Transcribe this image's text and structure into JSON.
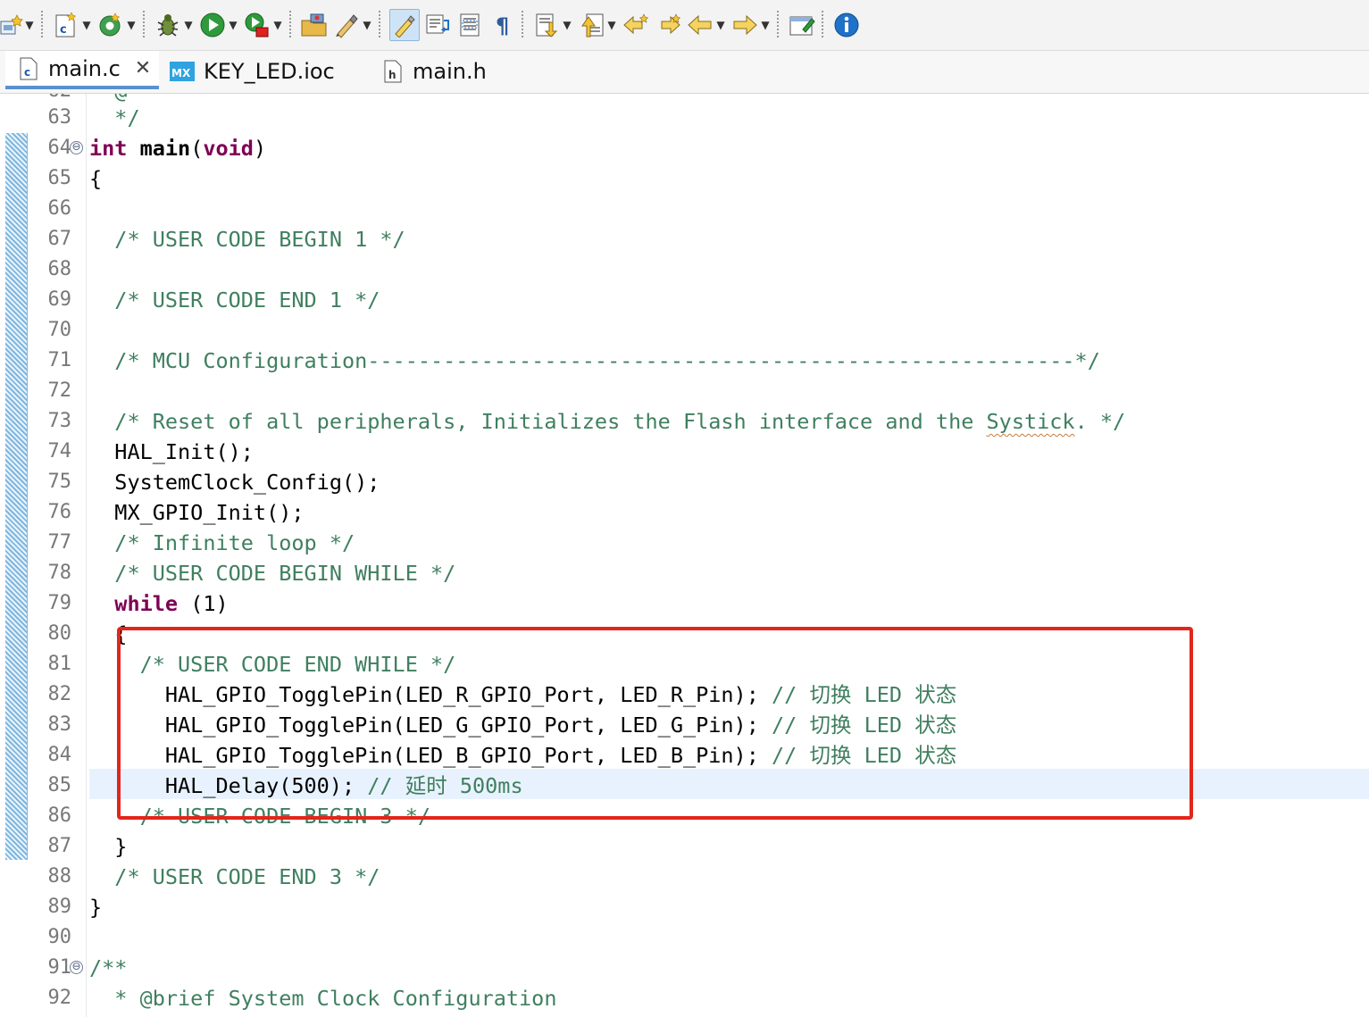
{
  "toolbar": {
    "icons": [
      "new-wizard-icon",
      "new-c-file-icon",
      "build-icon",
      "debug-icon",
      "run-icon",
      "external-tools-icon",
      "open-folder-icon",
      "toggle-mark-icon",
      "highlight-icon",
      "word-wrap-icon",
      "block-select-icon",
      "pilcrow-icon",
      "next-annotation-icon",
      "prev-annotation-icon",
      "last-edit-back-icon",
      "last-edit-forward-icon",
      "back-icon",
      "forward-icon",
      "open-perspective-icon",
      "info-icon"
    ],
    "accent": "#1e72c8"
  },
  "tabs": [
    {
      "label": "main.c",
      "icon": "c-file-icon",
      "active": true
    },
    {
      "label": "KEY_LED.ioc",
      "icon": "mx-ioc-icon",
      "active": false
    },
    {
      "label": "main.h",
      "icon": "h-file-icon",
      "active": false
    }
  ],
  "editor": {
    "lines": [
      {
        "n": "63",
        "text": "  */"
      },
      {
        "n": "64",
        "text": "int main(void)",
        "fold": "⊖"
      },
      {
        "n": "65",
        "text": "{"
      },
      {
        "n": "66",
        "text": ""
      },
      {
        "n": "67",
        "text": "  /* USER CODE BEGIN 1 */"
      },
      {
        "n": "68",
        "text": ""
      },
      {
        "n": "69",
        "text": "  /* USER CODE END 1 */"
      },
      {
        "n": "70",
        "text": ""
      },
      {
        "n": "71",
        "text": "  /* MCU Configuration--------------------------------------------------------*/"
      },
      {
        "n": "72",
        "text": ""
      },
      {
        "n": "73",
        "text": "  /* Reset of all peripherals, Initializes the Flash interface and the Systick. */"
      },
      {
        "n": "74",
        "text": "  HAL_Init();"
      },
      {
        "n": "75",
        "text": "  SystemClock_Config();"
      },
      {
        "n": "76",
        "text": "  MX_GPIO_Init();"
      },
      {
        "n": "77",
        "text": "  /* Infinite loop */"
      },
      {
        "n": "78",
        "text": "  /* USER CODE BEGIN WHILE */"
      },
      {
        "n": "79",
        "text": "  while (1)"
      },
      {
        "n": "80",
        "text": "  {"
      },
      {
        "n": "81",
        "text": "    /* USER CODE END WHILE */"
      },
      {
        "n": "82",
        "text": "      HAL_GPIO_TogglePin(LED_R_GPIO_Port, LED_R_Pin); // 切换 LED 状态"
      },
      {
        "n": "83",
        "text": "      HAL_GPIO_TogglePin(LED_G_GPIO_Port, LED_G_Pin); // 切换 LED 状态"
      },
      {
        "n": "84",
        "text": "      HAL_GPIO_TogglePin(LED_B_GPIO_Port, LED_B_Pin); // 切换 LED 状态"
      },
      {
        "n": "85",
        "text": "      HAL_Delay(500); // 延时 500ms"
      },
      {
        "n": "86",
        "text": "    /* USER CODE BEGIN 3 */"
      },
      {
        "n": "87",
        "text": "  }"
      },
      {
        "n": "88",
        "text": "  /* USER CODE END 3 */"
      },
      {
        "n": "89",
        "text": "}"
      },
      {
        "n": "90",
        "text": ""
      },
      {
        "n": "91",
        "text": "/**",
        "fold": "⊖"
      },
      {
        "n": "92",
        "text": "  * @brief System Clock Configuration"
      }
    ],
    "code_parts": {
      "l64_kw1": "int",
      "l64_fn": "main",
      "l64_p1": "(",
      "l64_kw2": "void",
      "l64_p2": ")",
      "l73_pre": "  /* Reset of all peripherals, Initializes the Flash interface and the ",
      "l73_squig": "Systick",
      "l73_post": ". */",
      "l79_kw": "while",
      "l79_rest": " (1)",
      "l82_code": "      HAL_GPIO_TogglePin(LED_R_GPIO_Port, LED_R_Pin); ",
      "l82_cmt": "// 切换 LED 状态",
      "l83_code": "      HAL_GPIO_TogglePin(LED_G_GPIO_Port, LED_G_Pin); ",
      "l83_cmt": "// 切换 LED 状态",
      "l84_code": "      HAL_GPIO_TogglePin(LED_B_GPIO_Port, LED_B_Pin); ",
      "l84_cmt": "// 切换 LED 状态",
      "l85_code": "      HAL_Delay(500); ",
      "l85_cmt": "// 延时 500ms"
    },
    "current_line": "85",
    "highlight_color": "#e2261c"
  }
}
